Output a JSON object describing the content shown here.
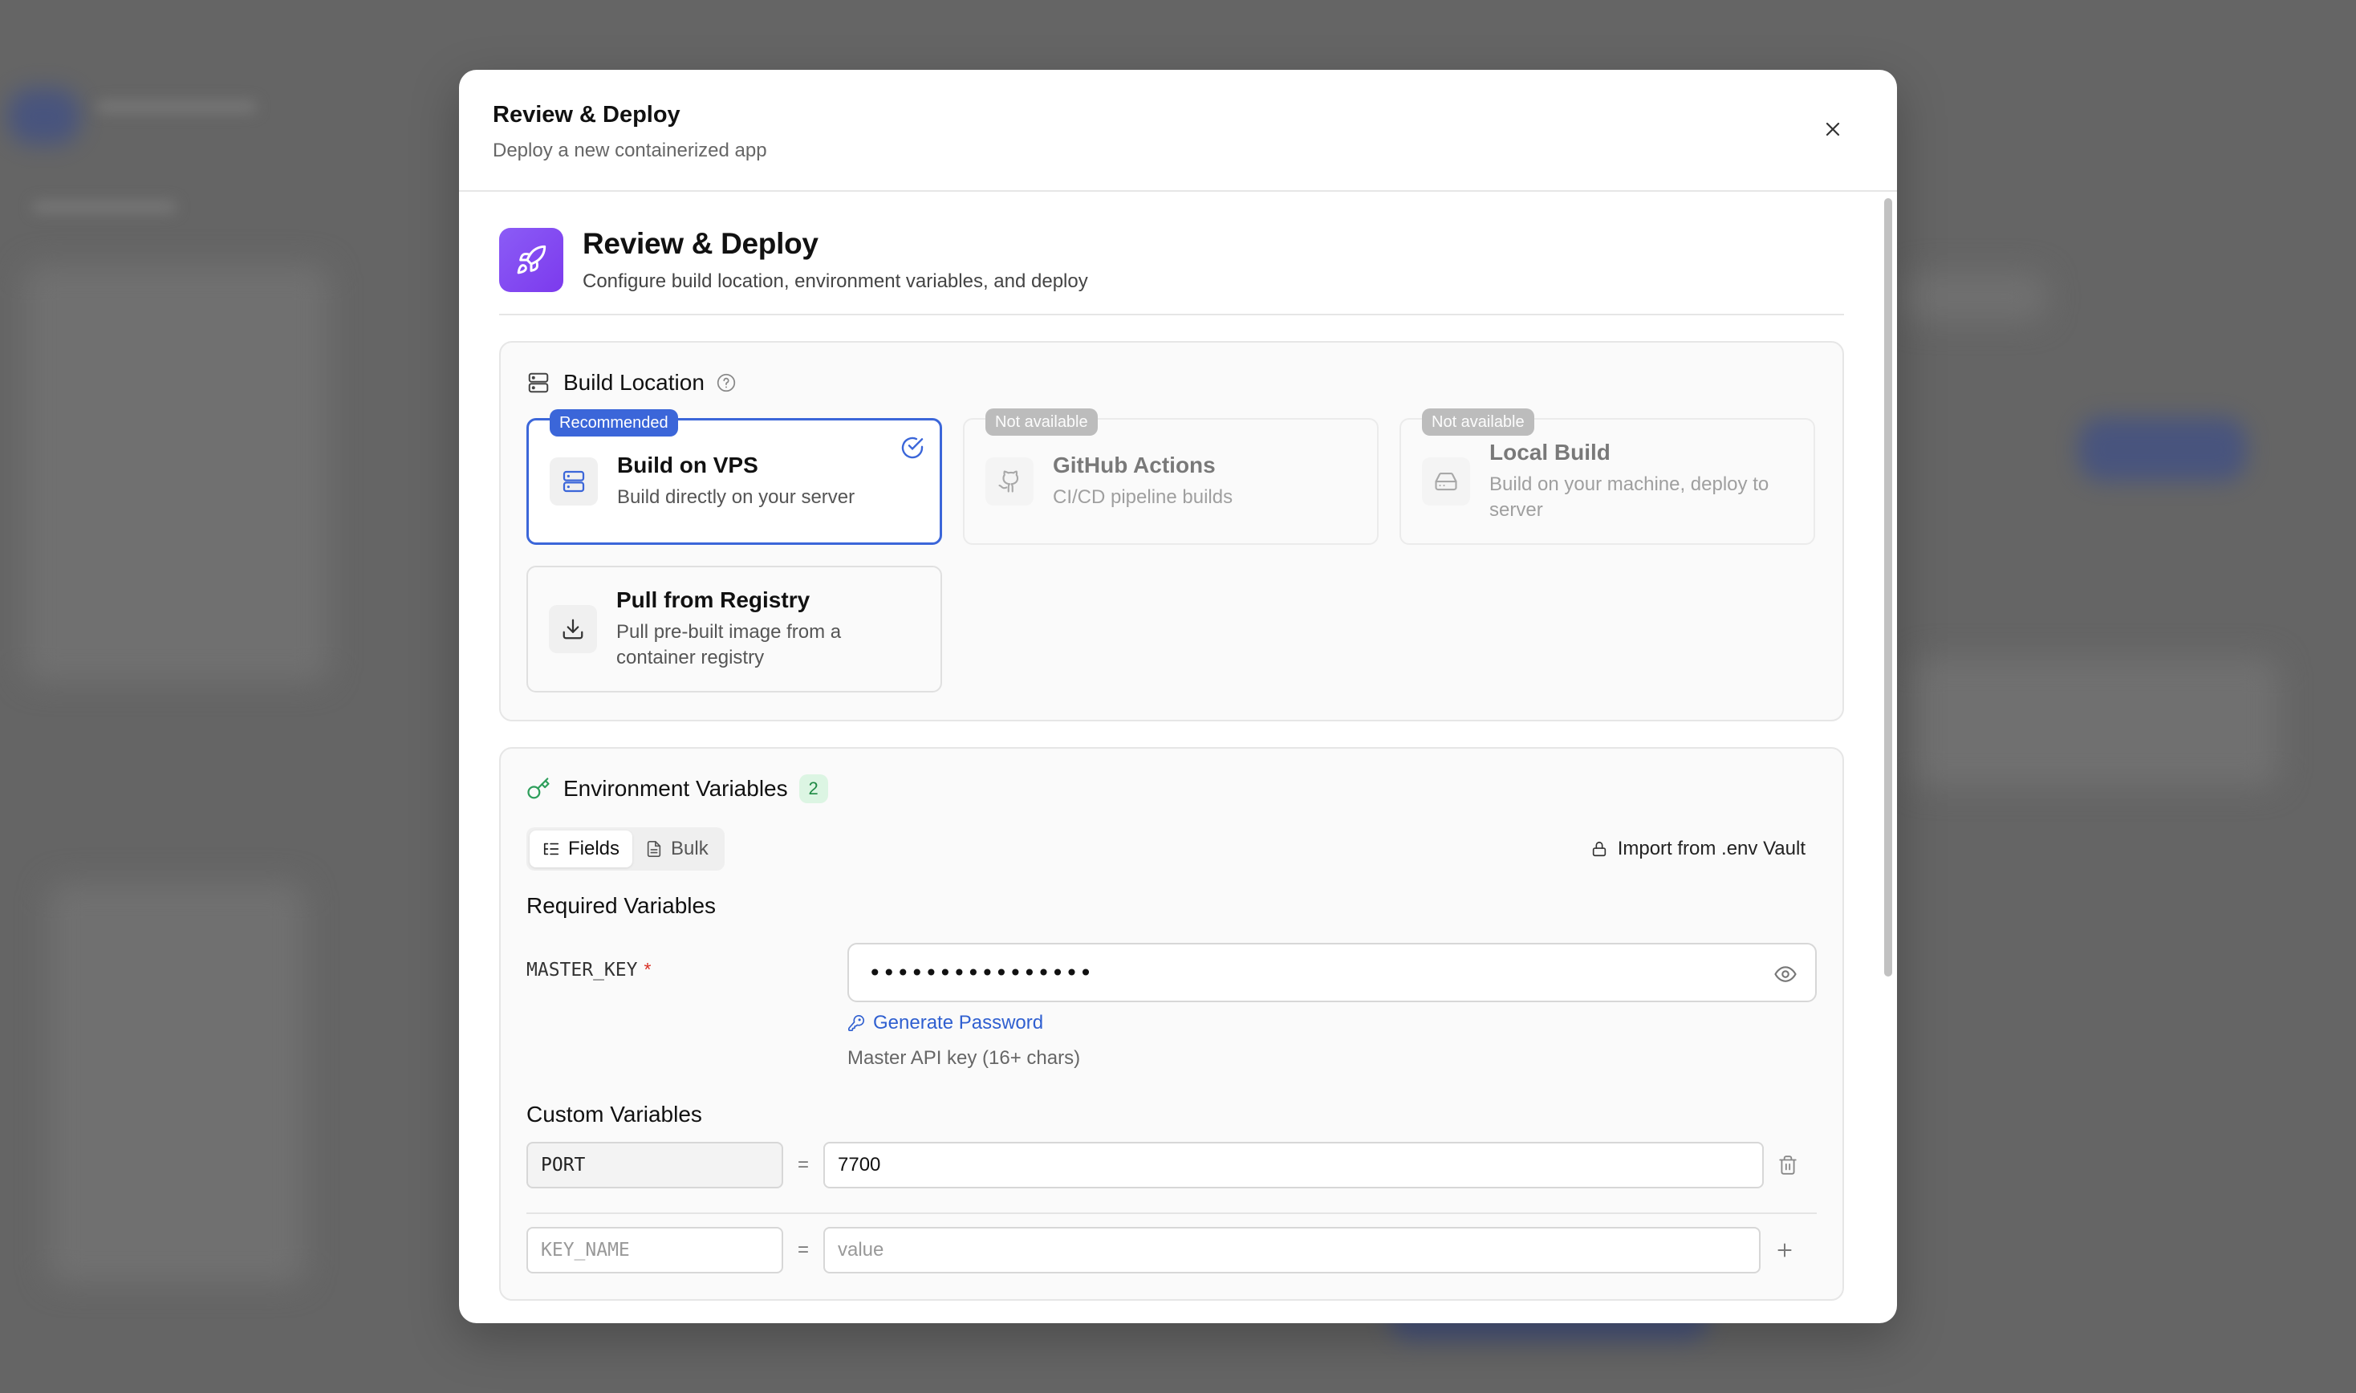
{
  "modal": {
    "title": "Review & Deploy",
    "subtitle": "Deploy a new containerized app"
  },
  "hero": {
    "title": "Review & Deploy",
    "description": "Configure build location, environment variables, and deploy"
  },
  "build_location": {
    "title": "Build Location",
    "options": [
      {
        "badge": "Recommended",
        "title": "Build on VPS",
        "description": "Build directly on your server",
        "selected": true,
        "icon": "server-icon"
      },
      {
        "badge": "Not available",
        "title": "GitHub Actions",
        "description": "CI/CD pipeline builds",
        "selected": false,
        "icon": "github-icon"
      },
      {
        "badge": "Not available",
        "title": "Local Build",
        "description": "Build on your machine, deploy to server",
        "selected": false,
        "icon": "hard-drive-icon"
      },
      {
        "badge": "",
        "title": "Pull from Registry",
        "description": "Pull pre-built image from a container registry",
        "selected": false,
        "icon": "download-icon"
      }
    ]
  },
  "env": {
    "title": "Environment Variables",
    "count": "2",
    "tabs": [
      {
        "label": "Fields",
        "active": true
      },
      {
        "label": "Bulk",
        "active": false
      }
    ],
    "import_label": "Import from .env Vault",
    "required_title": "Required Variables",
    "required": [
      {
        "key": "MASTER_KEY",
        "required_mark": "*",
        "value": "••••••••••••••••",
        "generate_label": "Generate Password",
        "hint": "Master API key (16+ chars)"
      }
    ],
    "custom_title": "Custom Variables",
    "custom": [
      {
        "key": "PORT",
        "value": "7700"
      }
    ],
    "new_row": {
      "key_placeholder": "KEY_NAME",
      "value_placeholder": "value",
      "equals": "="
    }
  },
  "colors": {
    "accent": "#3b66d9",
    "hero_gradient_start": "#8b5cf6",
    "count_green": "#1f8a45",
    "required_red": "#d93025"
  }
}
